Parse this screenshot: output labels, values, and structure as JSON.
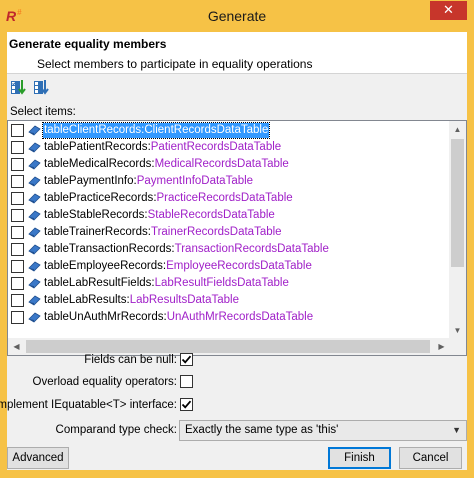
{
  "window": {
    "title": "Generate",
    "close_glyph": "✕",
    "app_icon": "R",
    "app_icon_sup": "#"
  },
  "header": {
    "title": "Generate equality members",
    "subtitle": "Select members to participate in equality operations"
  },
  "toolbar": {
    "buttons": [
      {
        "icon": "select-all-icon"
      },
      {
        "icon": "unselect-all-icon"
      }
    ]
  },
  "list": {
    "label": "Select items:",
    "items": [
      {
        "name": "tableClientRecords",
        "type": "ClientRecordsDataTable",
        "checked": false,
        "selected": true
      },
      {
        "name": "tablePatientRecords",
        "type": "PatientRecordsDataTable",
        "checked": false
      },
      {
        "name": "tableMedicalRecords",
        "type": "MedicalRecordsDataTable",
        "checked": false
      },
      {
        "name": "tablePaymentInfo",
        "type": "PaymentInfoDataTable",
        "checked": false
      },
      {
        "name": "tablePracticeRecords",
        "type": "PracticeRecordsDataTable",
        "checked": false
      },
      {
        "name": "tableStableRecords",
        "type": "StableRecordsDataTable",
        "checked": false
      },
      {
        "name": "tableTrainerRecords",
        "type": "TrainerRecordsDataTable",
        "checked": false
      },
      {
        "name": "tableTransactionRecords",
        "type": "TransactionRecordsDataTable",
        "checked": false
      },
      {
        "name": "tableEmployeeRecords",
        "type": "EmployeeRecordsDataTable",
        "checked": false
      },
      {
        "name": "tableLabResultFields",
        "type": "LabResultFieldsDataTable",
        "checked": false
      },
      {
        "name": "tableLabResults",
        "type": "LabResultsDataTable",
        "checked": false
      },
      {
        "name": "tableUnAuthMrRecords",
        "type": "UnAuthMrRecordsDataTable",
        "checked": false
      }
    ]
  },
  "options": {
    "nullable_label": "Fields can be null:",
    "nullable_checked": true,
    "overload_label": "Overload equality operators:",
    "overload_checked": false,
    "iequatable_label": "Implement IEquatable<T> interface:",
    "iequatable_checked": true,
    "comparand_label": "Comparand type check:",
    "comparand_value": "Exactly the same type as 'this'"
  },
  "footer": {
    "advanced_label": "Advanced",
    "finish_label": "Finish",
    "cancel_label": "Cancel"
  }
}
